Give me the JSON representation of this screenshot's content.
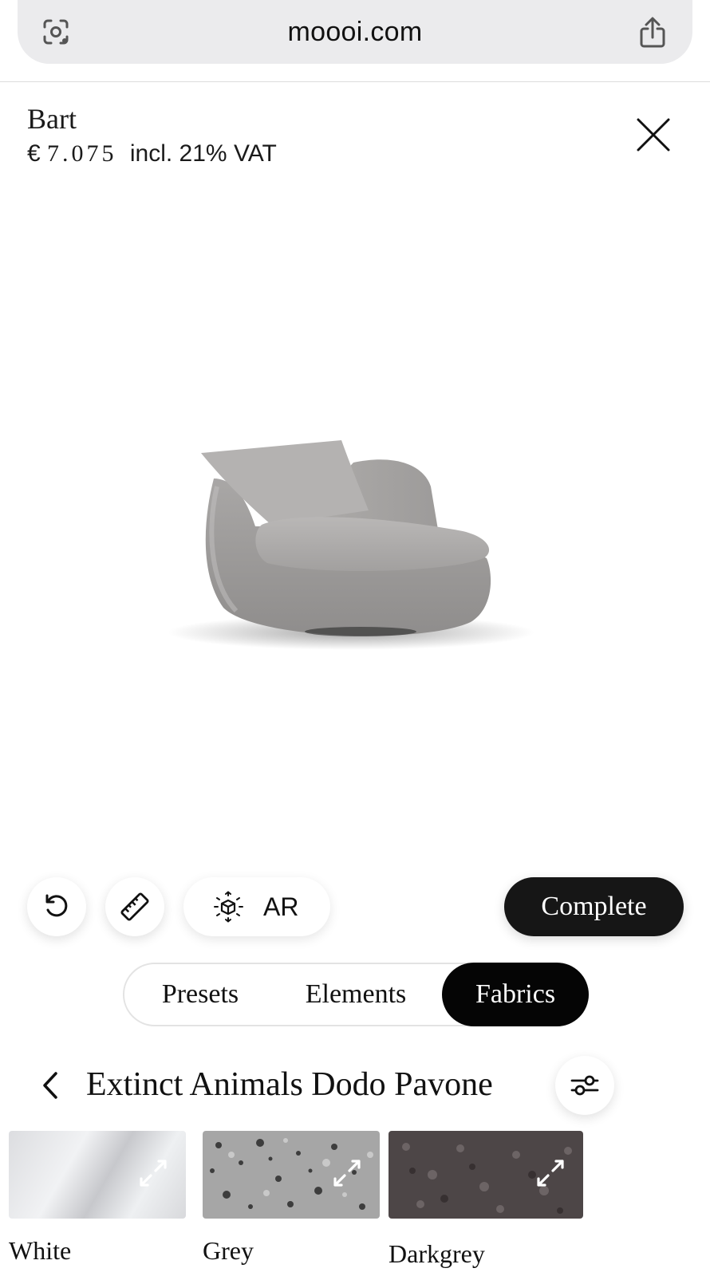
{
  "browser": {
    "url": "moooi.com"
  },
  "product": {
    "name": "Bart",
    "price_currency": "€",
    "price_amount": "7.075",
    "price_note": "incl. 21% VAT"
  },
  "toolbar": {
    "ar_label": "AR",
    "complete_label": "Complete"
  },
  "tabs": [
    {
      "label": "Presets",
      "active": false
    },
    {
      "label": "Elements",
      "active": false
    },
    {
      "label": "Fabrics",
      "active": true
    }
  ],
  "collection": {
    "name": "Extinct Animals Dodo Pavone"
  },
  "swatches": [
    {
      "name": "White",
      "color": "#e6e7ea"
    },
    {
      "name": "Grey",
      "color": "#a6a6a6"
    },
    {
      "name": "Darkgrey",
      "color": "#4d4647"
    }
  ],
  "icons": {
    "lens": "camera-lens-icon",
    "share": "share-icon",
    "close": "close-icon",
    "undo": "undo-icon",
    "ruler": "ruler-icon",
    "ar": "ar-cube-icon",
    "back": "chevron-left-icon",
    "filter": "sliders-icon",
    "expand": "expand-icon"
  }
}
